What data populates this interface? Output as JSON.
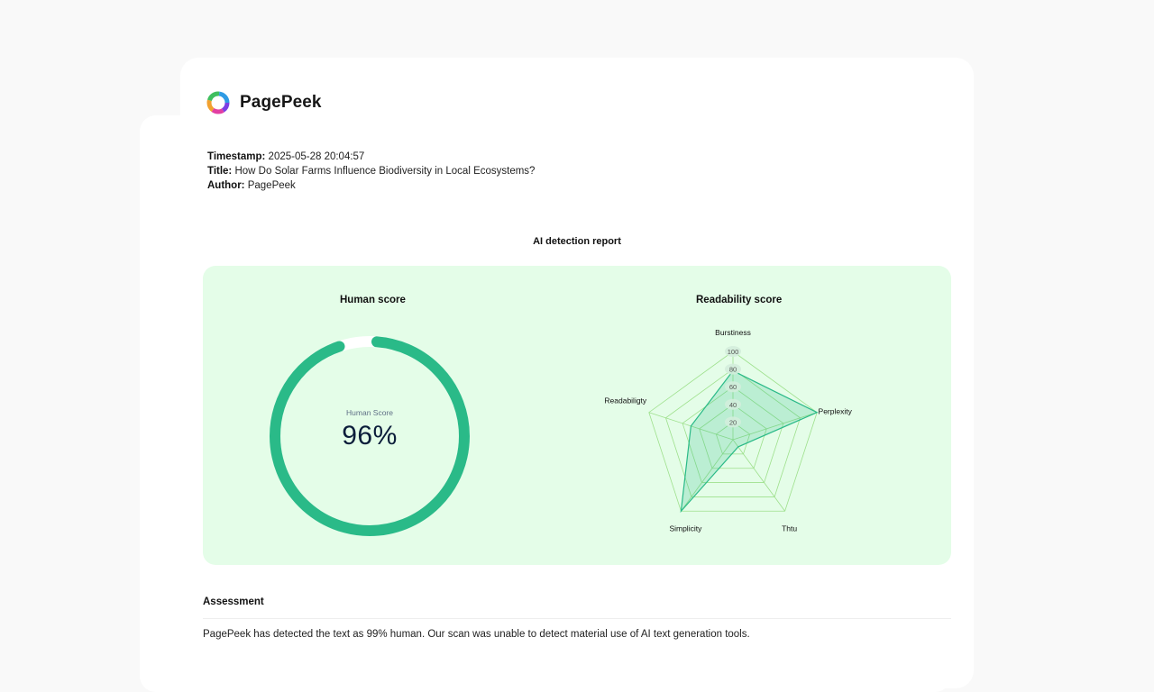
{
  "brand": {
    "name": "PagePeek"
  },
  "meta": {
    "timestamp_label": "Timestamp:",
    "timestamp": "2025-05-28 20:04:57",
    "title_label": "Title:",
    "title": "How Do Solar Farms Influence Biodiversity in Local Ecosystems?",
    "author_label": "Author:",
    "author": "PagePeek"
  },
  "report": {
    "title": "AI detection report"
  },
  "human_score": {
    "title": "Human score",
    "label": "Human Score",
    "value_text": "96%",
    "value": 96
  },
  "readability": {
    "title": "Readability score"
  },
  "colors": {
    "accent": "#2aba88",
    "panel_bg": "#e4fde8",
    "grid": "#9ee08c"
  },
  "chart_data": {
    "type": "radar",
    "title": "Readability score",
    "axes": [
      "Burstiness",
      "Perplexity",
      "Thtu",
      "Simplicity",
      "Readabiligty"
    ],
    "ticks": [
      20,
      40,
      60,
      80,
      100
    ],
    "range": [
      0,
      100
    ],
    "values": [
      78,
      100,
      10,
      100,
      50
    ],
    "grid": true
  },
  "assessment": {
    "title": "Assessment",
    "text": "PagePeek has detected the text as 99% human. Our scan was unable to detect material use of AI text generation tools."
  }
}
